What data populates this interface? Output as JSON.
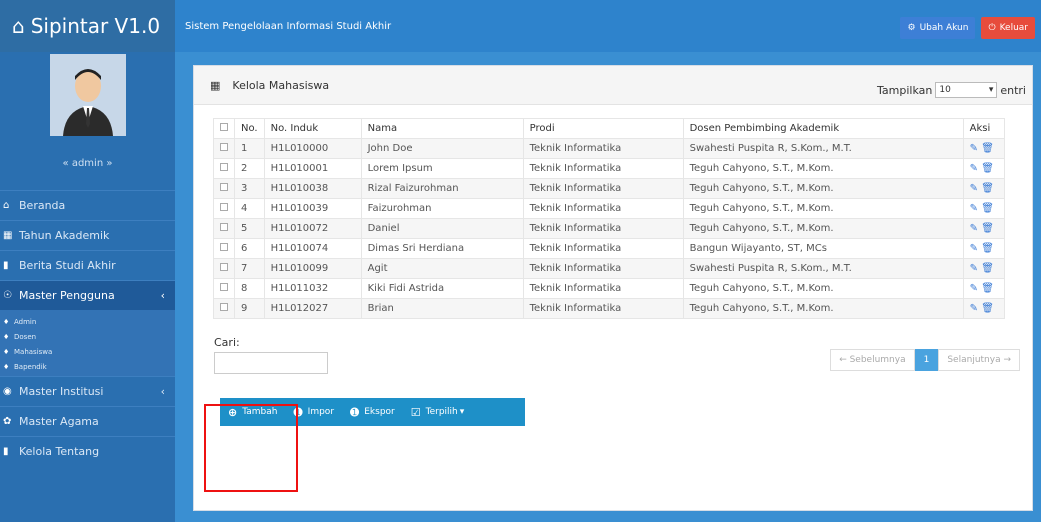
{
  "brand": {
    "title": "Sipintar V1.0",
    "icon": "home-icon"
  },
  "topbar": {
    "subtitle": "Sistem Pengelolaan Informasi Studi Akhir",
    "change_account": "Ubah Akun",
    "logout": "Keluar"
  },
  "sidebar": {
    "admin_name": "« admin »",
    "items": [
      {
        "label": "Beranda",
        "icon": "home-icon"
      },
      {
        "label": "Tahun Akademik",
        "icon": "calendar-icon"
      },
      {
        "label": "Berita Studi Akhir",
        "icon": "bookmark-icon"
      },
      {
        "label": "Master Pengguna",
        "icon": "users-icon"
      },
      {
        "label": "Master Institusi",
        "icon": "globe-icon"
      },
      {
        "label": "Master Agama",
        "icon": "leaf-icon"
      },
      {
        "label": "Kelola Tentang",
        "icon": "bookmark-icon"
      }
    ],
    "submenu": [
      "Admin",
      "Dosen",
      "Mahasiswa",
      "Bapendik"
    ]
  },
  "panel": {
    "title": "Kelola Mahasiswa",
    "show_label": "Tampilkan",
    "show_value": "10",
    "entries_label": "entri"
  },
  "table": {
    "headers": [
      "No.",
      "No. Induk",
      "Nama",
      "Prodi",
      "Dosen Pembimbing Akademik",
      "Aksi"
    ],
    "rows": [
      [
        "1",
        "H1L010000",
        "John Doe",
        "Teknik Informatika",
        "Swahesti Puspita R, S.Kom., M.T."
      ],
      [
        "2",
        "H1L010001",
        "Lorem Ipsum",
        "Teknik Informatika",
        "Teguh Cahyono, S.T., M.Kom."
      ],
      [
        "3",
        "H1L010038",
        "Rizal Faizurohman",
        "Teknik Informatika",
        "Teguh Cahyono, S.T., M.Kom."
      ],
      [
        "4",
        "H1L010039",
        "Faizurohman",
        "Teknik Informatika",
        "Teguh Cahyono, S.T., M.Kom."
      ],
      [
        "5",
        "H1L010072",
        "Daniel",
        "Teknik Informatika",
        "Teguh Cahyono, S.T., M.Kom."
      ],
      [
        "6",
        "H1L010074",
        "Dimas Sri Herdiana",
        "Teknik Informatika",
        "Bangun Wijayanto, ST, MCs"
      ],
      [
        "7",
        "H1L010099",
        "Agit",
        "Teknik Informatika",
        "Swahesti Puspita R, S.Kom., M.T."
      ],
      [
        "8",
        "H1L011032",
        "Kiki Fidi Astrida",
        "Teknik Informatika",
        "Teguh Cahyono, S.T., M.Kom."
      ],
      [
        "9",
        "H1L012027",
        "Brian",
        "Teknik Informatika",
        "Teguh Cahyono, S.T., M.Kom."
      ]
    ]
  },
  "search": {
    "label": "Cari:",
    "value": ""
  },
  "pager": {
    "prev": "← Sebelumnya",
    "current": "1",
    "next": "Selanjutnya →"
  },
  "actions": {
    "add": "Tambah",
    "import": "Impor",
    "export": "Ekspor",
    "selected": "Terpilih"
  },
  "colors": {
    "brand": "#2e6da4",
    "topbar": "#2e83cc",
    "sidebar": "#2a6fb0",
    "content_bg": "#3a8fd2",
    "logout": "#e74c3c",
    "highlight": "#ee1111"
  }
}
